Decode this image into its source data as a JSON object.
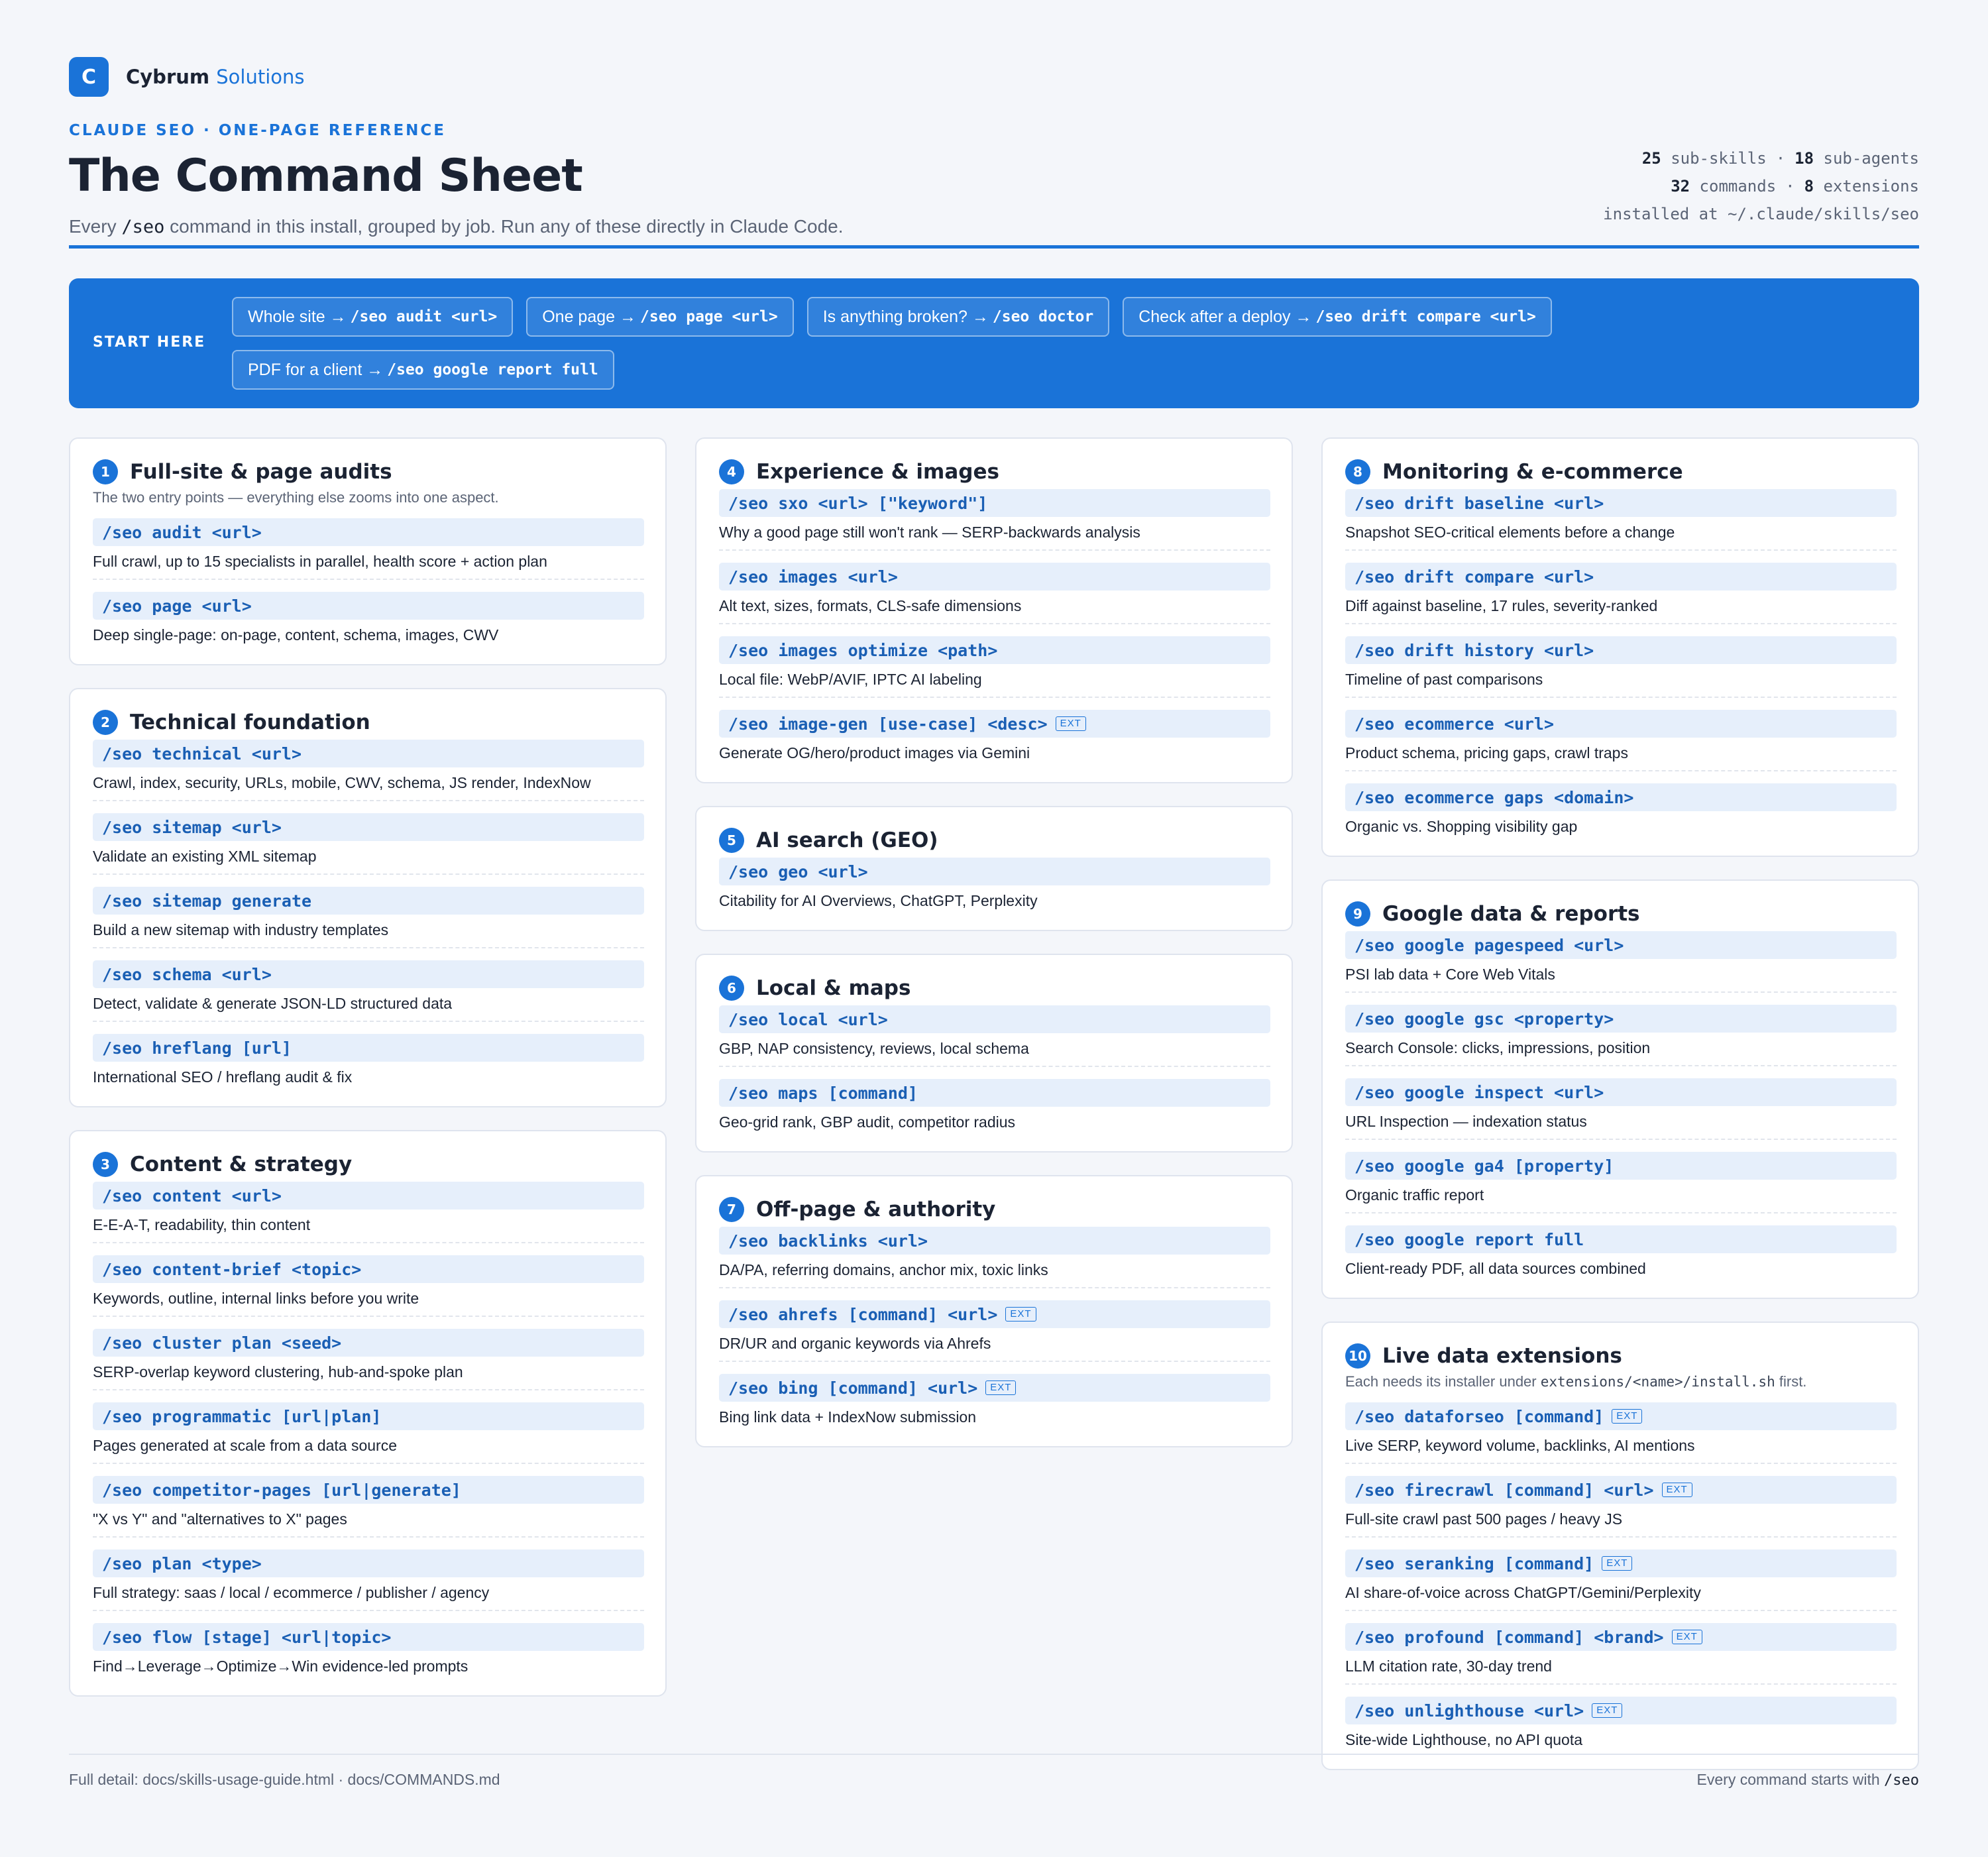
{
  "brand": {
    "logo_letter": "C",
    "name": "Cybrum",
    "accent": "Solutions",
    "accent_color": "#1a73d8"
  },
  "eyebrow": "CLAUDE SEO · ONE-PAGE REFERENCE",
  "title": "The Command Sheet",
  "subtitle": {
    "before": "Every ",
    "code": "/seo",
    "after": " command in this install, grouped by job. Run any of these directly in Claude Code."
  },
  "stats": {
    "sub_skills_num": "25",
    "sub_skills_label": "sub-skills",
    "sub_agents_num": "18",
    "sub_agents_label": "sub-agents",
    "commands_num": "32",
    "commands_label": "commands",
    "extensions_num": "8",
    "extensions_label": "extensions",
    "install_path": "installed at ~/.claude/skills/seo"
  },
  "start_here": {
    "label": "START HERE",
    "chips": [
      {
        "text": "Whole site →",
        "cmd": "/seo audit <url>"
      },
      {
        "text": "One page →",
        "cmd": "/seo page <url>"
      },
      {
        "text": "Is anything broken? →",
        "cmd": "/seo doctor"
      },
      {
        "text": "Check after a deploy →",
        "cmd": "/seo drift compare <url>"
      },
      {
        "text": "PDF for a client →",
        "cmd": "/seo google report full"
      }
    ]
  },
  "ext_label": "EXT",
  "sections": [
    {
      "num": "1",
      "title": "Full-site & page audits",
      "subtitle": "The two entry points — everything else zooms into one aspect.",
      "commands": [
        {
          "cmd": "/seo audit <url>",
          "desc": "Full crawl, up to 15 specialists in parallel, health score + action plan"
        },
        {
          "cmd": "/seo page <url>",
          "desc": "Deep single-page: on-page, content, schema, images, CWV"
        }
      ]
    },
    {
      "num": "2",
      "title": "Technical foundation",
      "commands": [
        {
          "cmd": "/seo technical <url>",
          "desc": "Crawl, index, security, URLs, mobile, CWV, schema, JS render, IndexNow"
        },
        {
          "cmd": "/seo sitemap <url>",
          "desc": "Validate an existing XML sitemap"
        },
        {
          "cmd": "/seo sitemap generate",
          "desc": "Build a new sitemap with industry templates"
        },
        {
          "cmd": "/seo schema <url>",
          "desc": "Detect, validate & generate JSON-LD structured data"
        },
        {
          "cmd": "/seo hreflang [url]",
          "desc": "International SEO / hreflang audit & fix"
        }
      ]
    },
    {
      "num": "3",
      "title": "Content & strategy",
      "commands": [
        {
          "cmd": "/seo content <url>",
          "desc": "E-E-A-T, readability, thin content"
        },
        {
          "cmd": "/seo content-brief <topic>",
          "desc": "Keywords, outline, internal links before you write"
        },
        {
          "cmd": "/seo cluster plan <seed>",
          "desc": "SERP-overlap keyword clustering, hub-and-spoke plan"
        },
        {
          "cmd": "/seo programmatic [url|plan]",
          "desc": "Pages generated at scale from a data source"
        },
        {
          "cmd": "/seo competitor-pages [url|generate]",
          "desc": "\"X vs Y\" and \"alternatives to X\" pages"
        },
        {
          "cmd": "/seo plan <type>",
          "desc": "Full strategy: saas / local / ecommerce / publisher / agency"
        },
        {
          "cmd": "/seo flow [stage] <url|topic>",
          "desc": "Find→Leverage→Optimize→Win evidence-led prompts"
        }
      ]
    },
    {
      "num": "4",
      "title": "Experience & images",
      "commands": [
        {
          "cmd": "/seo sxo <url> [\"keyword\"]",
          "desc": "Why a good page still won't rank — SERP-backwards analysis"
        },
        {
          "cmd": "/seo images <url>",
          "desc": "Alt text, sizes, formats, CLS-safe dimensions"
        },
        {
          "cmd": "/seo images optimize <path>",
          "desc": "Local file: WebP/AVIF, IPTC AI labeling"
        },
        {
          "cmd": "/seo image-gen [use-case] <desc>",
          "desc": "Generate OG/hero/product images via Gemini",
          "ext": true
        }
      ]
    },
    {
      "num": "5",
      "title": "AI search (GEO)",
      "commands": [
        {
          "cmd": "/seo geo <url>",
          "desc": "Citability for AI Overviews, ChatGPT, Perplexity"
        }
      ]
    },
    {
      "num": "6",
      "title": "Local & maps",
      "commands": [
        {
          "cmd": "/seo local <url>",
          "desc": "GBP, NAP consistency, reviews, local schema"
        },
        {
          "cmd": "/seo maps [command]",
          "desc": "Geo-grid rank, GBP audit, competitor radius"
        }
      ]
    },
    {
      "num": "7",
      "title": "Off-page & authority",
      "commands": [
        {
          "cmd": "/seo backlinks <url>",
          "desc": "DA/PA, referring domains, anchor mix, toxic links"
        },
        {
          "cmd": "/seo ahrefs [command] <url>",
          "desc": "DR/UR and organic keywords via Ahrefs",
          "ext": true
        },
        {
          "cmd": "/seo bing [command] <url>",
          "desc": "Bing link data + IndexNow submission",
          "ext": true
        }
      ]
    },
    {
      "num": "8",
      "title": "Monitoring & e-commerce",
      "commands": [
        {
          "cmd": "/seo drift baseline <url>",
          "desc": "Snapshot SEO-critical elements before a change"
        },
        {
          "cmd": "/seo drift compare <url>",
          "desc": "Diff against baseline, 17 rules, severity-ranked"
        },
        {
          "cmd": "/seo drift history <url>",
          "desc": "Timeline of past comparisons"
        },
        {
          "cmd": "/seo ecommerce <url>",
          "desc": "Product schema, pricing gaps, crawl traps"
        },
        {
          "cmd": "/seo ecommerce gaps <domain>",
          "desc": "Organic vs. Shopping visibility gap"
        }
      ]
    },
    {
      "num": "9",
      "title": "Google data & reports",
      "commands": [
        {
          "cmd": "/seo google pagespeed <url>",
          "desc": "PSI lab data + Core Web Vitals"
        },
        {
          "cmd": "/seo google gsc <property>",
          "desc": "Search Console: clicks, impressions, position"
        },
        {
          "cmd": "/seo google inspect <url>",
          "desc": "URL Inspection — indexation status"
        },
        {
          "cmd": "/seo google ga4 [property]",
          "desc": "Organic traffic report"
        },
        {
          "cmd": "/seo google report full",
          "desc": "Client-ready PDF, all data sources combined"
        }
      ]
    },
    {
      "num": "10",
      "title": "Live data extensions",
      "subtitle_before": "Each needs its installer under ",
      "subtitle_code": "extensions/<name>/install.sh",
      "subtitle_after": " first.",
      "commands": [
        {
          "cmd": "/seo dataforseo [command]",
          "desc": "Live SERP, keyword volume, backlinks, AI mentions",
          "ext": true
        },
        {
          "cmd": "/seo firecrawl [command] <url>",
          "desc": "Full-site crawl past 500 pages / heavy JS",
          "ext": true
        },
        {
          "cmd": "/seo seranking [command]",
          "desc": "AI share-of-voice across ChatGPT/Gemini/Perplexity",
          "ext": true
        },
        {
          "cmd": "/seo profound [command] <brand>",
          "desc": "LLM citation rate, 30-day trend",
          "ext": true
        },
        {
          "cmd": "/seo unlighthouse <url>",
          "desc": "Site-wide Lighthouse, no API quota",
          "ext": true
        }
      ]
    }
  ],
  "footer": {
    "left": "Full detail: docs/skills-usage-guide.html · docs/COMMANDS.md",
    "right_before": "Every command starts with ",
    "right_code": "/seo"
  }
}
